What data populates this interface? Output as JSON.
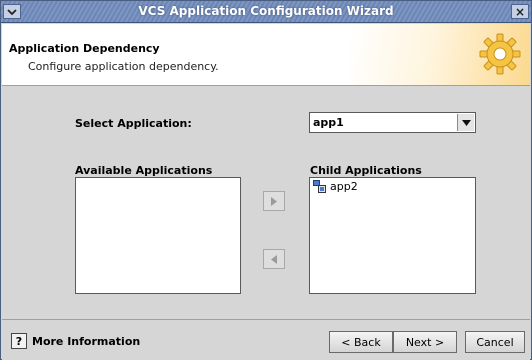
{
  "window": {
    "title": "VCS Application Configuration Wizard",
    "menu_icon": "chevron-down-icon",
    "close_label": "×"
  },
  "header": {
    "title": "Application Dependency",
    "subtitle": "Configure application dependency.",
    "icon": "gear-icon",
    "accent_color": "#f6c445"
  },
  "form": {
    "select_label": "Select Application:",
    "selected_app": "app1",
    "available_label": "Available Applications",
    "available_items": [],
    "child_label": "Child Applications",
    "child_items": [
      {
        "label": "app2",
        "icon": "application-icon"
      }
    ],
    "add_icon": "arrow-right-icon",
    "remove_icon": "arrow-left-icon"
  },
  "footer": {
    "help_glyph": "?",
    "more_info_label": "More Information",
    "back_label": "< Back",
    "next_label": "Next >",
    "cancel_label": "Cancel"
  },
  "colors": {
    "titlebar": "#6c86b5",
    "panel": "#d6d6d6",
    "header_bg": "#ffffff"
  }
}
